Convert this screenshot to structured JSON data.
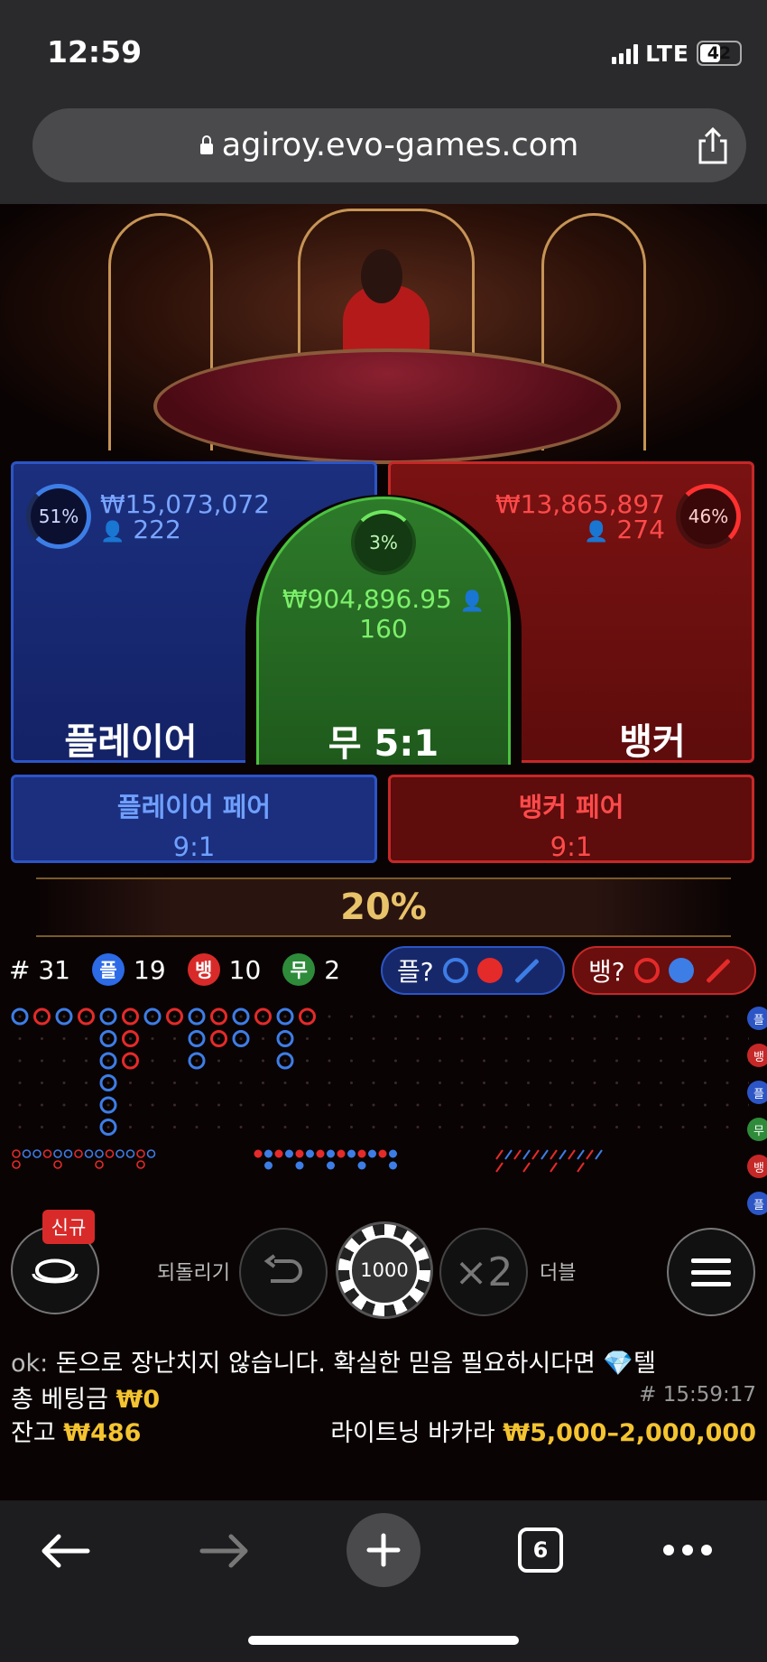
{
  "status_bar": {
    "time": "12:59",
    "network": "LTE",
    "battery": "42"
  },
  "browser": {
    "url": "agiroy.evo-games.com",
    "tab_count": "6"
  },
  "player": {
    "percent": "51%",
    "amount": "₩15,073,072",
    "players": "222",
    "label": "플레이어"
  },
  "banker": {
    "percent": "46%",
    "amount": "₩13,865,897",
    "players": "274",
    "label": "뱅커"
  },
  "tie": {
    "percent": "3%",
    "amount": "₩904,896.95",
    "players": "160",
    "label": "무 5:1"
  },
  "player_pair": {
    "label": "플레이어 페어",
    "payout": "9:1"
  },
  "banker_pair": {
    "label": "뱅커 페어",
    "payout": "9:1"
  },
  "bonus_percent": "20%",
  "counts": {
    "round": "# 31",
    "player_badge": "플",
    "player_count": "19",
    "banker_badge": "뱅",
    "banker_count": "10",
    "tie_badge": "무",
    "tie_count": "2"
  },
  "predictions": {
    "player_label": "플?",
    "banker_label": "뱅?"
  },
  "side_chips": [
    "플",
    "뱅",
    "플",
    "무",
    "뱅",
    "플"
  ],
  "controls": {
    "new_badge": "신규",
    "undo_label": "되돌리기",
    "chip_value": "1000",
    "double_symbol": "×2",
    "double_label": "더블"
  },
  "chat": {
    "user": "ok:",
    "message": "돈으로 장난치지 않습니다. 확실한 믿음 필요하시다면 💎텔"
  },
  "bets": {
    "total_label": "총 베팅금",
    "total_value": "₩0",
    "game_id": "# 15:59:17",
    "balance_label": "잔고",
    "balance_value": "₩486",
    "game_name": "라이트닝 바카라",
    "limits": "₩5,000–2,000,000"
  },
  "colors": {
    "player": "#2c55c6",
    "banker": "#c62828",
    "tie": "#4cc241",
    "gold": "#f4c430"
  }
}
